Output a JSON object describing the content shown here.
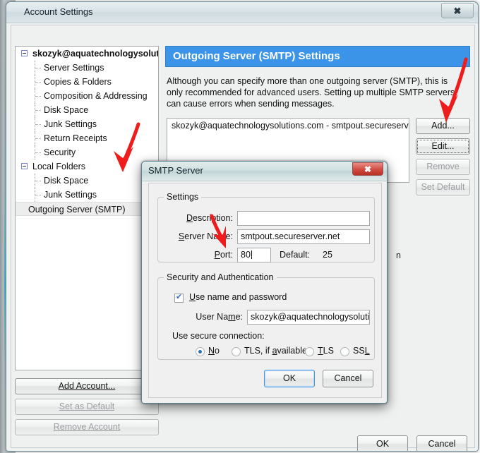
{
  "window": {
    "title": "Account Settings",
    "close_label": "✖",
    "ok_label": "OK",
    "cancel_label": "Cancel"
  },
  "sidebar": {
    "account_root": "skozyk@aquatechnologysoluti...",
    "account_children": [
      "Server Settings",
      "Copies & Folders",
      "Composition & Addressing",
      "Disk Space",
      "Junk Settings",
      "Return Receipts",
      "Security"
    ],
    "local_root": "Local Folders",
    "local_children": [
      "Disk Space",
      "Junk Settings"
    ],
    "selected_item": "Outgoing Server (SMTP)",
    "buttons": [
      {
        "label": "Add Account...",
        "enabled": true
      },
      {
        "label": "Set as Default",
        "enabled": false
      },
      {
        "label": "Remove Account",
        "enabled": false
      }
    ]
  },
  "panel": {
    "header": "Outgoing Server (SMTP) Settings",
    "description": "Although you can specify more than one outgoing server (SMTP), this is only recommended for advanced users. Setting up multiple SMTP servers can cause errors when sending messages.",
    "server_list": [
      "skozyk@aquatechnologysolutions.com - smtpout.secureserv..."
    ],
    "buttons": [
      {
        "label": "Add...",
        "enabled": true,
        "focused": false
      },
      {
        "label": "Edit...",
        "enabled": true,
        "focused": true
      },
      {
        "label": "Remove",
        "enabled": false,
        "focused": false
      },
      {
        "label": "Set Default",
        "enabled": false,
        "focused": false
      }
    ],
    "behind_fragment": "n"
  },
  "dialog": {
    "title": "SMTP Server",
    "close_label": "✖",
    "settings_legend": "Settings",
    "description_label": "Description:",
    "description_value": "",
    "server_name_label": "Server Name:",
    "server_name_value": "smtpout.secureserver.net",
    "port_label": "Port:",
    "port_value": "80",
    "default_label": "Default:",
    "default_value": "25",
    "security_legend": "Security and Authentication",
    "use_name_password_label": "Use name and password",
    "use_name_password_checked": true,
    "user_name_label": "User Name:",
    "user_name_value": "skozyk@aquatechnologysolutions.",
    "secure_connection_label": "Use secure connection:",
    "secure_options": [
      {
        "label": "No",
        "selected": true
      },
      {
        "label": "TLS, if available",
        "selected": false
      },
      {
        "label": "TLS",
        "selected": false
      },
      {
        "label": "SSL",
        "selected": false
      }
    ],
    "ok_label": "OK",
    "cancel_label": "Cancel"
  },
  "annotations": {
    "arrow_color": "#ee1c1c",
    "arrows": [
      {
        "name": "arrow-to-outgoing-server",
        "target": "Outgoing Server (SMTP)"
      },
      {
        "name": "arrow-to-edit-button",
        "target": "Edit..."
      },
      {
        "name": "arrow-to-port-field",
        "target": "Port"
      }
    ]
  }
}
